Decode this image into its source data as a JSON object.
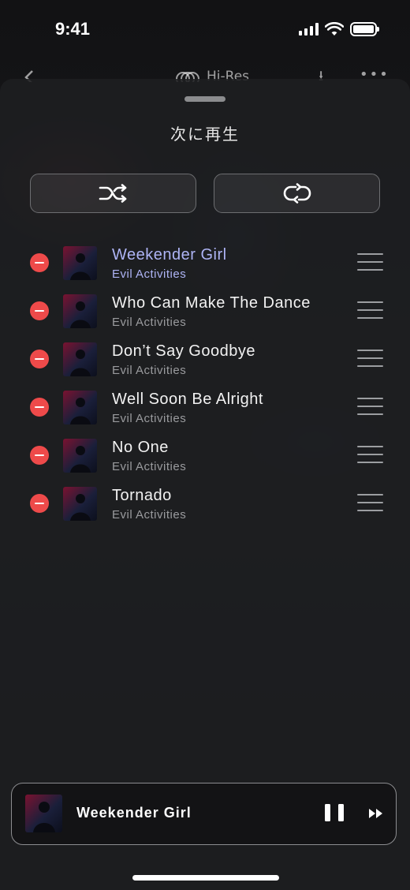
{
  "status_bar": {
    "time": "9:41"
  },
  "background_nav": {
    "badge": "Hi-Res"
  },
  "sheet": {
    "title": "次に再生"
  },
  "controls": {
    "shuffle_icon": "shuffle-icon",
    "repeat_icon": "repeat-icon"
  },
  "queue": [
    {
      "title": "Weekender Girl",
      "artist": "Evil Activities",
      "current": true
    },
    {
      "title": "Who Can Make The Dance",
      "artist": "Evil Activities",
      "current": false
    },
    {
      "title": "Don’t Say Goodbye",
      "artist": "Evil Activities",
      "current": false
    },
    {
      "title": "Well Soon Be Alright",
      "artist": "Evil Activities",
      "current": false
    },
    {
      "title": "No One",
      "artist": "Evil Activities",
      "current": false
    },
    {
      "title": "Tornado",
      "artist": "Evil Activities",
      "current": false
    }
  ],
  "mini_player": {
    "title": "Weekender Girl"
  },
  "colors": {
    "accent": "#aeb4f5",
    "remove": "#ee4a4a",
    "sheet": "#1e1f21"
  }
}
